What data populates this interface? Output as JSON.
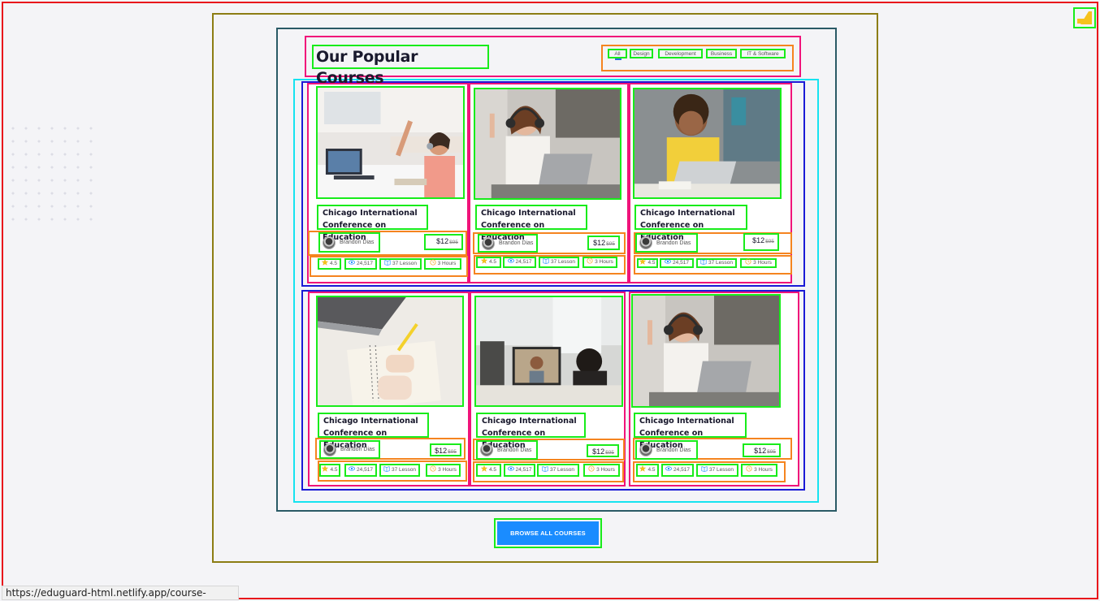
{
  "section": {
    "title": "Our Popular Courses",
    "tabs": [
      "All",
      "Design",
      "Development",
      "Business",
      "IT & Software"
    ],
    "browse_button": "BROWSE ALL COURSES"
  },
  "courses": [
    {
      "title_line1": "Chicago International",
      "title_line2": "Conference on Education",
      "author": "Brandon Dias",
      "price": "$12",
      "old_price": "$95",
      "rating": "4.5",
      "views": "24,517",
      "lessons": "37 Lesson",
      "duration": "3 Hours",
      "image": "girl-laptop-class-photo"
    },
    {
      "title_line1": "Chicago International",
      "title_line2": "Conference on Education",
      "author": "Brandon Dias",
      "price": "$12",
      "old_price": "$95",
      "rating": "4.5",
      "views": "24,517",
      "lessons": "37 Lesson",
      "duration": "3 Hours",
      "image": "woman-headphones-laptop-photo"
    },
    {
      "title_line1": "Chicago International",
      "title_line2": "Conference on Education",
      "author": "Brandon Dias",
      "price": "$12",
      "old_price": "$95",
      "rating": "4.5",
      "views": "24,517",
      "lessons": "37 Lesson",
      "duration": "3 Hours",
      "image": "man-yellow-shirt-laptop-photo"
    },
    {
      "title_line1": "Chicago International",
      "title_line2": "Conference on Education",
      "author": "Brandon Dias",
      "price": "$12",
      "old_price": "$95",
      "rating": "4.5",
      "views": "24,517",
      "lessons": "37 Lesson",
      "duration": "3 Hours",
      "image": "hand-writing-notebook-photo"
    },
    {
      "title_line1": "Chicago International",
      "title_line2": "Conference on Education",
      "author": "Brandon Dias",
      "price": "$12",
      "old_price": "$95",
      "rating": "4.5",
      "views": "24,517",
      "lessons": "37 Lesson",
      "duration": "3 Hours",
      "image": "child-video-call-photo"
    },
    {
      "title_line1": "Chicago International",
      "title_line2": "Conference on Education",
      "author": "Brandon Dias",
      "price": "$12",
      "old_price": "$95",
      "rating": "4.5",
      "views": "24,517",
      "lessons": "37 Lesson",
      "duration": "3 Hours",
      "image": "woman-headphones-laptop-photo"
    }
  ],
  "status_url": "https://eduguard-html.netlify.app/course-details.html",
  "colors": {
    "accent": "#1a8cff",
    "star": "#f6c21c",
    "page_bg": "#f4f4f7"
  }
}
